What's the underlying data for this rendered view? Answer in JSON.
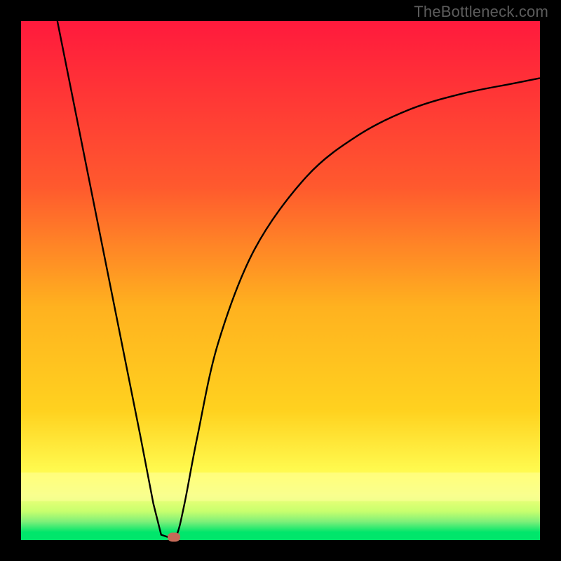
{
  "watermark": "TheBottleneck.com",
  "chart_data": {
    "type": "line",
    "title": "",
    "xlabel": "",
    "ylabel": "",
    "xlim": [
      0,
      100
    ],
    "ylim": [
      0,
      100
    ],
    "gradient_colors": {
      "top": "#ff1a3d",
      "upper_mid": "#ff7a2a",
      "mid": "#ffd21f",
      "lower_mid": "#ffff55",
      "band": "#f1ff7a",
      "bottom": "#00e66b"
    },
    "curve_points": [
      {
        "x": 7,
        "y": 100
      },
      {
        "x": 11,
        "y": 80
      },
      {
        "x": 15,
        "y": 60
      },
      {
        "x": 19,
        "y": 40
      },
      {
        "x": 23,
        "y": 20
      },
      {
        "x": 25.5,
        "y": 7
      },
      {
        "x": 27,
        "y": 1
      },
      {
        "x": 28.5,
        "y": 0.5
      },
      {
        "x": 30,
        "y": 1
      },
      {
        "x": 31.5,
        "y": 7
      },
      {
        "x": 34,
        "y": 20
      },
      {
        "x": 38,
        "y": 38
      },
      {
        "x": 45,
        "y": 56
      },
      {
        "x": 55,
        "y": 70
      },
      {
        "x": 65,
        "y": 78
      },
      {
        "x": 75,
        "y": 83
      },
      {
        "x": 85,
        "y": 86
      },
      {
        "x": 95,
        "y": 88
      },
      {
        "x": 100,
        "y": 89
      }
    ],
    "marker": {
      "x": 29.5,
      "y": 0.5,
      "color": "#c46a58"
    }
  }
}
